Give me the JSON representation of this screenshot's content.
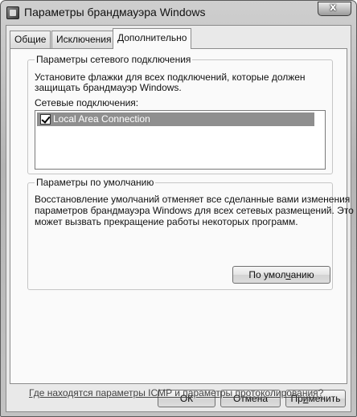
{
  "window": {
    "title": "Параметры брандмауэра Windows",
    "close_label": "x"
  },
  "tabs": [
    {
      "label": "Общие"
    },
    {
      "label": "Исключения"
    },
    {
      "label": "Дополнительно",
      "active": true
    }
  ],
  "network_group": {
    "title": "Параметры сетевого подключения",
    "description_line1": "Установите флажки для всех подключений, которые должен",
    "description_line2": "защищать брандмауэр Windows.",
    "list_label": "Сетевые подключения:",
    "connections": [
      {
        "label": "Local Area Connection",
        "checked": true,
        "selected": true
      }
    ]
  },
  "defaults_group": {
    "title": "Параметры по умолчанию",
    "line1": "Восстановление умолчаний отменяет все сделанные вами изменения",
    "line2": "параметров брандмауэра Windows для всех сетевых размещений. Это",
    "line3": "может вызвать прекращение работы некоторых программ.",
    "button_pre": "По умол",
    "button_accel": "ч",
    "button_post": "анию"
  },
  "link_text": "Где находятся параметры ICMP и параметры протоколирования?",
  "buttons": {
    "ok": "ОК",
    "cancel": "Отмена",
    "apply_pre": "Пр",
    "apply_accel": "и",
    "apply_post": "менить"
  }
}
